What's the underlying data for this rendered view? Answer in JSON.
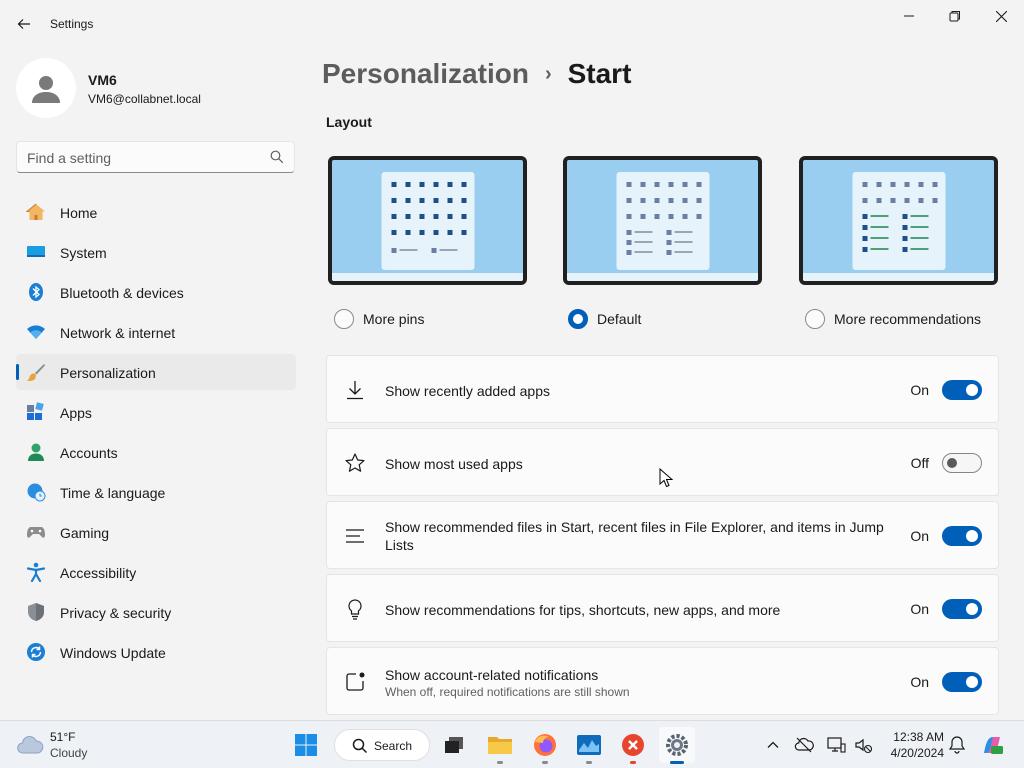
{
  "app": {
    "title": "Settings"
  },
  "window_controls": [
    "minimize",
    "maximize",
    "close"
  ],
  "user": {
    "name": "VM6",
    "email": "VM6@collabnet.local"
  },
  "search": {
    "placeholder": "Find a setting"
  },
  "nav": {
    "items": [
      {
        "label": "Home",
        "icon": "home-icon",
        "selected": false
      },
      {
        "label": "System",
        "icon": "system-icon",
        "selected": false
      },
      {
        "label": "Bluetooth & devices",
        "icon": "bluetooth-icon",
        "selected": false
      },
      {
        "label": "Network & internet",
        "icon": "wifi-icon",
        "selected": false
      },
      {
        "label": "Personalization",
        "icon": "brush-icon",
        "selected": true
      },
      {
        "label": "Apps",
        "icon": "apps-icon",
        "selected": false
      },
      {
        "label": "Accounts",
        "icon": "accounts-icon",
        "selected": false
      },
      {
        "label": "Time & language",
        "icon": "time-language-icon",
        "selected": false
      },
      {
        "label": "Gaming",
        "icon": "gaming-icon",
        "selected": false
      },
      {
        "label": "Accessibility",
        "icon": "accessibility-icon",
        "selected": false
      },
      {
        "label": "Privacy & security",
        "icon": "shield-icon",
        "selected": false
      },
      {
        "label": "Windows Update",
        "icon": "update-icon",
        "selected": false
      }
    ]
  },
  "breadcrumb": {
    "parent": "Personalization",
    "separator": "›",
    "current": "Start"
  },
  "layout": {
    "title": "Layout",
    "options": [
      {
        "label": "More pins",
        "selected": false
      },
      {
        "label": "Default",
        "selected": true
      },
      {
        "label": "More recommendations",
        "selected": false
      }
    ]
  },
  "settings": [
    {
      "label": "Show recently added apps",
      "sublabel": "",
      "state": "On",
      "on": true,
      "icon": "download-icon"
    },
    {
      "label": "Show most used apps",
      "sublabel": "",
      "state": "Off",
      "on": false,
      "icon": "star-icon"
    },
    {
      "label": "Show recommended files in Start, recent files in File Explorer, and items in Jump Lists",
      "sublabel": "",
      "state": "On",
      "on": true,
      "icon": "list-icon"
    },
    {
      "label": "Show recommendations for tips, shortcuts, new apps, and more",
      "sublabel": "",
      "state": "On",
      "on": true,
      "icon": "lightbulb-icon"
    },
    {
      "label": "Show account-related notifications",
      "sublabel": "When off, required notifications are still shown",
      "state": "On",
      "on": true,
      "icon": "notification-badge-icon"
    }
  ],
  "taskbar": {
    "weather": {
      "temp": "51°F",
      "desc": "Cloudy"
    },
    "search_label": "Search",
    "apps": [
      "start-icon",
      "task-view-icon",
      "file-explorer-icon",
      "firefox-icon",
      "task-manager-icon",
      "xmind-icon",
      "settings-app-icon"
    ],
    "clock": {
      "time": "12:38 AM",
      "date": "4/20/2024"
    }
  },
  "colors": {
    "accent": "#005fb8",
    "background": "#f3f3f3",
    "card": "#fbfbfb"
  }
}
